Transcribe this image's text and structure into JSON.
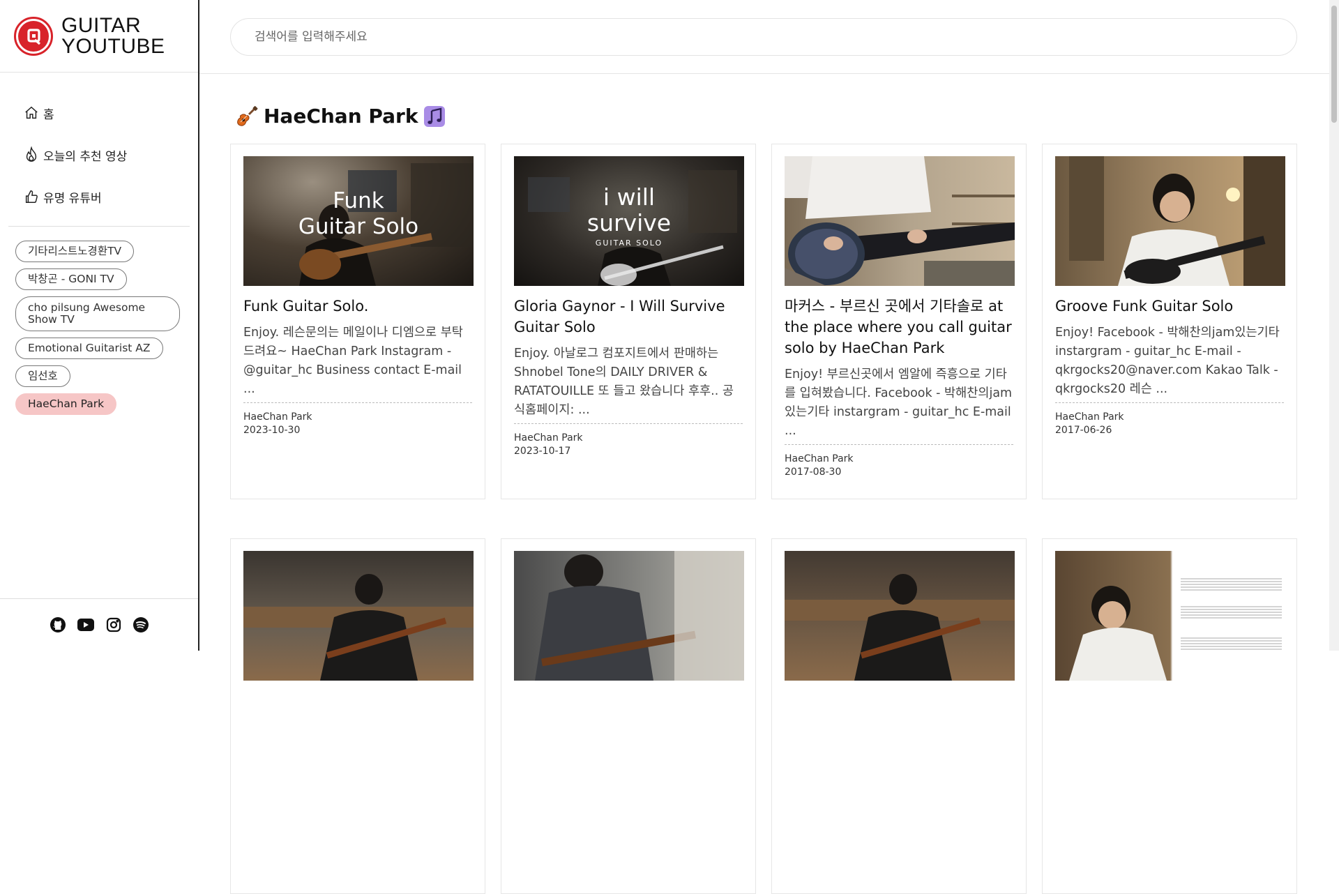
{
  "app": {
    "logo_line1": "GUITAR",
    "logo_line2": "YOUTUBE",
    "brand_color": "#d8232a"
  },
  "search": {
    "placeholder": "검색어를 입력해주세요"
  },
  "sidebar": {
    "nav": [
      {
        "label": "홈",
        "icon": "home-icon"
      },
      {
        "label": "오늘의 추천 영상",
        "icon": "fire-icon"
      },
      {
        "label": "유명 유튜버",
        "icon": "thumbs-up-icon"
      }
    ],
    "channels": [
      {
        "label": "기타리스트노경환TV"
      },
      {
        "label": "박창곤 - GONI TV"
      },
      {
        "label": "cho pilsung Awesome Show TV"
      },
      {
        "label": "Emotional Guitarist AZ"
      },
      {
        "label": "임선호"
      },
      {
        "label": "HaeChan Park",
        "active": true
      }
    ],
    "footer_icons": [
      "github-icon",
      "youtube-icon",
      "instagram-icon",
      "spotify-icon"
    ]
  },
  "section": {
    "title": "HaeChan Park",
    "left_emoji": "guitar-icon",
    "right_emoji": "music-note-icon"
  },
  "videos": [
    {
      "title": "Funk Guitar Solo.",
      "thumb_text": "Funk\nGuitar Solo",
      "description": "Enjoy. 레슨문의는 메일이나 디엠으로 부탁드려요~ HaeChan Park Instagram - @guitar_hc Business contact E-mail ...",
      "channel": "HaeChan Park",
      "date": "2023-10-30"
    },
    {
      "title": "Gloria Gaynor - I Will Survive Guitar Solo",
      "thumb_text": "i will\nsurvive",
      "thumb_sub": "GUITAR SOLO",
      "description": "Enjoy. 아날로그 컴포지트에서 판매하는 Shnobel Tone의 DAILY DRIVER & RATATOUILLE 또 들고 왔습니다 후후.. 공식홈페이지: ...",
      "channel": "HaeChan Park",
      "date": "2023-10-17"
    },
    {
      "title": "마커스 - 부르신 곳에서 기타솔로 at the place where you call guitar solo by HaeChan Park",
      "description": "Enjoy! 부르신곳에서 엠알에 즉흥으로 기타를 입혀봤습니다. Facebook - 박해찬의jam있는기타 instargram - guitar_hc E-mail ...",
      "channel": "HaeChan Park",
      "date": "2017-08-30"
    },
    {
      "title": "Groove Funk Guitar Solo",
      "description": "Enjoy! Facebook - 박해찬의jam있는기타 instargram - guitar_hc E-mail - qkrgocks20@naver.com Kakao Talk - qkrgocks20 레슨 ...",
      "channel": "HaeChan Park",
      "date": "2017-06-26"
    }
  ],
  "colors": {
    "active_chip": "#f6c6c6",
    "sidebar_border": "#222222"
  }
}
